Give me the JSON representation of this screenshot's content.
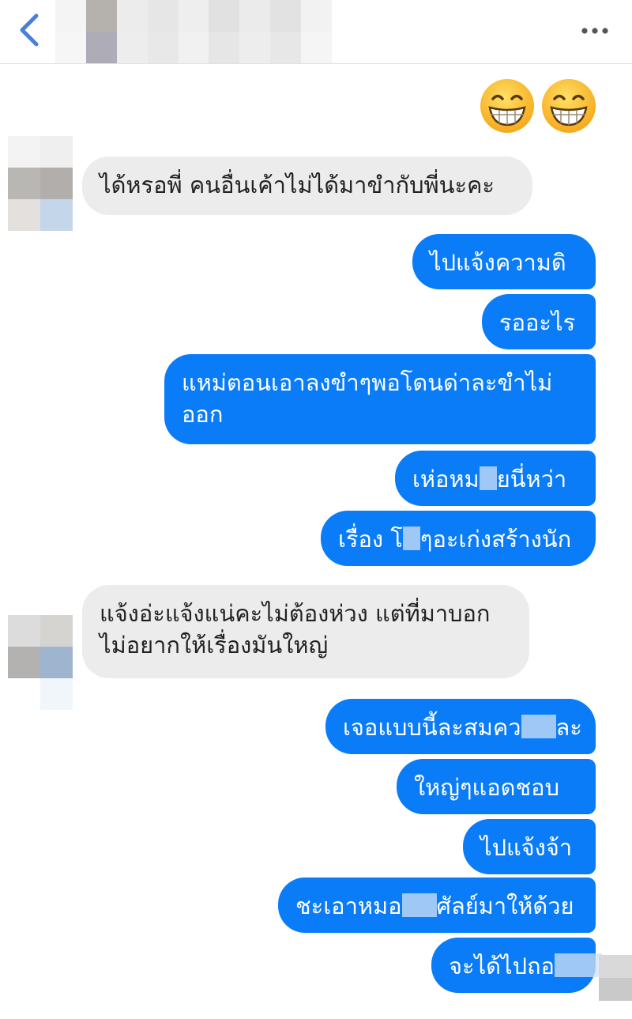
{
  "header": {
    "back_icon": "chevron-left-icon",
    "more_icon": "more-horizontal-icon",
    "accent": "#4a7fd8"
  },
  "emoji_reaction": "😁😁",
  "conversation": {
    "incoming_1": {
      "text": "ได้หรอพี่ คนอื่นเค้าไม่ได้มาขำกับพี่นะคะ"
    },
    "outgoing_group_1": [
      "ไปแจ้งความดิ",
      "รออะไร",
      "แหม่ตอนเอาลงขำๆพอโดนด่าละขำไม่",
      "ออก"
    ],
    "outgoing_masked_1": {
      "before": "เห่อหม",
      "after": "ยนี่หว่า"
    },
    "outgoing_masked_2": {
      "before": "เรื่อง โ",
      "after": "ๆอะเก่งสร้างนัก"
    },
    "incoming_2": {
      "line1": "แจ้งอ่ะแจ้งแน่คะไม่ต้องห่วง แต่ที่มาบอก",
      "line2": "ไม่อยากให้เรื่องมันใหญ่"
    },
    "outgoing_masked_3": {
      "before": "เจอแบบนี้ละสมคว",
      "after": "ละ"
    },
    "outgoing_group_2": [
      "ใหญ่ๆแอดชอบ",
      "ไปแจ้งจ้า"
    ],
    "outgoing_masked_4": {
      "before": "ชะเอาหมอ",
      "after": "ศัลย์มาให้ด้วย"
    },
    "outgoing_masked_5": {
      "before": "จะได้ไปถอ",
      "after": ""
    }
  },
  "colors": {
    "outgoing_bubble": "#0a7cf8",
    "incoming_bubble": "#ececec"
  }
}
